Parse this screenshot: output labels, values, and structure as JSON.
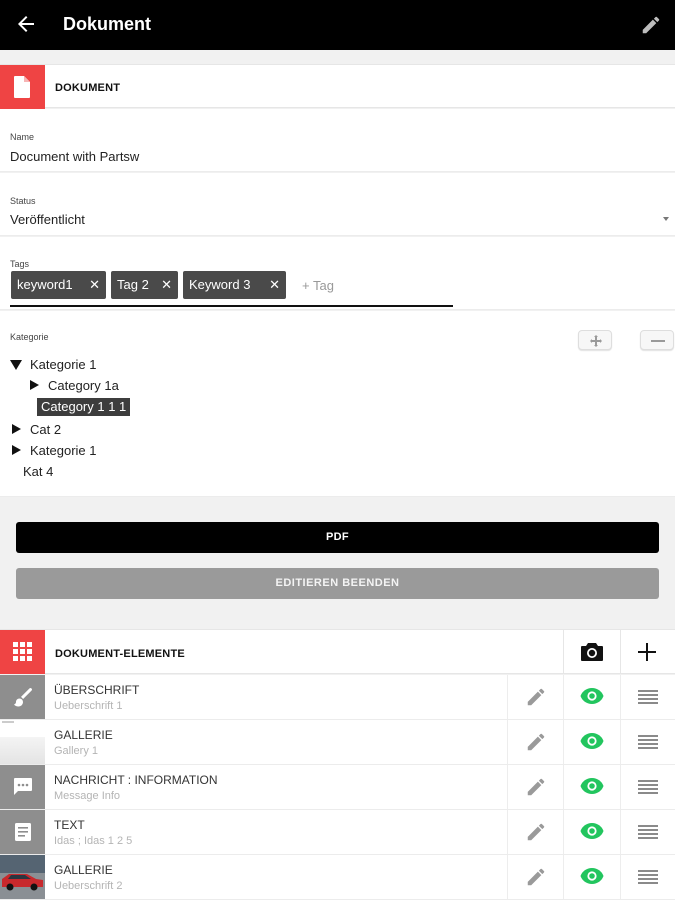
{
  "appbar": {
    "title": "Dokument",
    "back_icon": "arrow-left-icon",
    "edit_icon": "pencil-icon"
  },
  "document_section": {
    "title": "DOKUMENT",
    "icon": "document-icon"
  },
  "name_field": {
    "label": "Name",
    "value": "Document with Partsw"
  },
  "status_field": {
    "label": "Status",
    "value": "Veröffentlicht"
  },
  "tags_field": {
    "label": "Tags",
    "tags": [
      {
        "label": "keyword1"
      },
      {
        "label": "Tag 2"
      },
      {
        "label": "Keyword 3"
      }
    ],
    "remove_glyph": "✕",
    "add_placeholder": "+ Tag"
  },
  "kategorie": {
    "label": "Kategorie",
    "tree": [
      {
        "label": "Kategorie 1",
        "state": "expanded"
      },
      {
        "label": "Category 1a",
        "state": "collapsed"
      },
      {
        "label": "Category 1 1 1",
        "state": "selected"
      },
      {
        "label": "Cat 2",
        "state": "collapsed"
      },
      {
        "label": "Kategorie 1",
        "state": "collapsed"
      },
      {
        "label": "Kat 4",
        "state": "leaf"
      }
    ]
  },
  "buttons": {
    "pdf": "PDF",
    "end_edit": "EDITIEREN BEENDEN"
  },
  "elements_section": {
    "title": "DOKUMENT-ELEMENTE",
    "icon": "grid-icon",
    "camera_icon": "camera-icon",
    "add_icon": "plus-icon"
  },
  "elements": [
    {
      "type": "ÜBERSCHRIFT",
      "subtitle": "Ueberschrift 1",
      "icon": "brush-icon"
    },
    {
      "type": "GALLERIE",
      "subtitle": "Gallery 1",
      "icon": "image-thumbnail"
    },
    {
      "type": "NACHRICHT : INFORMATION",
      "subtitle": "Message Info",
      "icon": "message-icon"
    },
    {
      "type": "TEXT",
      "subtitle": "Idas ; Idas 1 2 5",
      "icon": "text-document-icon"
    },
    {
      "type": "GALLERIE",
      "subtitle": "Ueberschrift 2",
      "icon": "car-image-thumbnail"
    }
  ],
  "colors": {
    "accent_red": "#ef4444",
    "visible_green": "#22c55e",
    "appbar": "#000000"
  }
}
